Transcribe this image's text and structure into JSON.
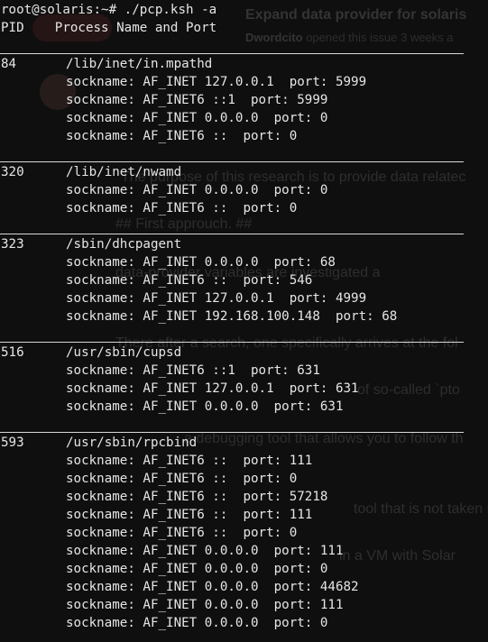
{
  "terminal": {
    "prompt": "root@solaris:~# ./pcp.ksh -a",
    "header_pid": "PID",
    "header_name": "Process Name and Port"
  },
  "processes": [
    {
      "pid": "84",
      "name": "/lib/inet/in.mpathd",
      "sockets": [
        "sockname: AF_INET 127.0.0.1  port: 5999",
        "sockname: AF_INET6 ::1  port: 5999",
        "sockname: AF_INET 0.0.0.0  port: 0",
        "sockname: AF_INET6 ::  port: 0"
      ]
    },
    {
      "pid": "320",
      "name": "/lib/inet/nwamd",
      "sockets": [
        "sockname: AF_INET 0.0.0.0  port: 0",
        "sockname: AF_INET6 ::  port: 0"
      ]
    },
    {
      "pid": "323",
      "name": "/sbin/dhcpagent",
      "sockets": [
        "sockname: AF_INET 0.0.0.0  port: 68",
        "sockname: AF_INET6 ::  port: 546",
        "sockname: AF_INET 127.0.0.1  port: 4999",
        "sockname: AF_INET 192.168.100.148  port: 68"
      ]
    },
    {
      "pid": "516",
      "name": "/usr/sbin/cupsd",
      "sockets": [
        "sockname: AF_INET6 ::1  port: 631",
        "sockname: AF_INET 127.0.0.1  port: 631",
        "sockname: AF_INET 0.0.0.0  port: 631"
      ]
    },
    {
      "pid": "593",
      "name": "/usr/sbin/rpcbind",
      "sockets": [
        "sockname: AF_INET6 ::  port: 111",
        "sockname: AF_INET6 ::  port: 0",
        "sockname: AF_INET6 ::  port: 57218",
        "sockname: AF_INET6 ::  port: 111",
        "sockname: AF_INET6 ::  port: 0",
        "sockname: AF_INET 0.0.0.0  port: 111",
        "sockname: AF_INET 0.0.0.0  port: 0",
        "sockname: AF_INET 0.0.0.0  port: 44682",
        "sockname: AF_INET 0.0.0.0  port: 111",
        "sockname: AF_INET 0.0.0.0  port: 0"
      ]
    }
  ],
  "background_page": {
    "issue_title": "Expand data provider for solaris",
    "author": "Dwordcito",
    "opened_text": "opened this issue 3 weeks a",
    "lines": [
      "The purpose of this research is to provide data relatec",
      "## First approuch. ##",
      "data-provider variables are investigated a",
      "There after a search, one specifically arrives at the fol",
      "of so-called `pto",
      "a debugging tool that allows you to follow th",
      "tool that is not taken in",
      "in a VM with Solar"
    ]
  }
}
